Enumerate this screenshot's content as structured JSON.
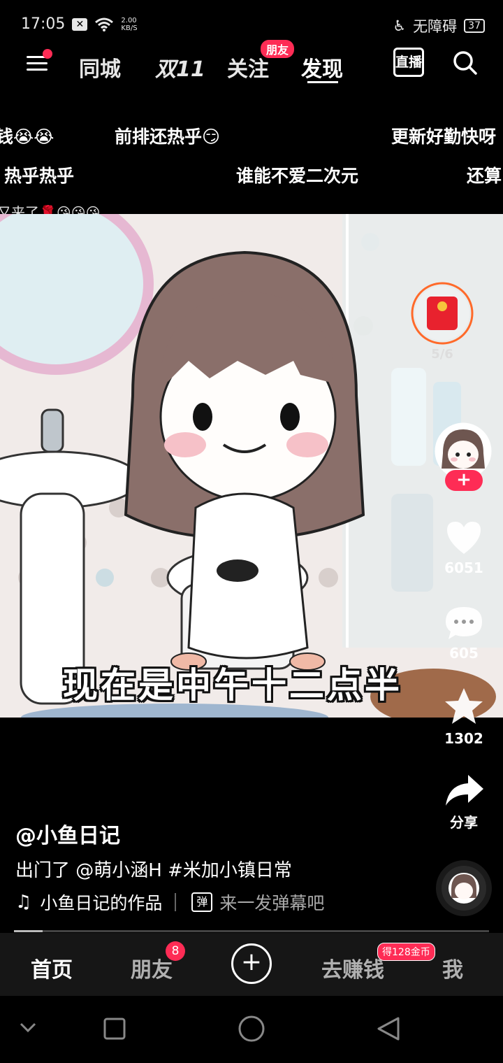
{
  "status": {
    "time": "17:05",
    "netspeed_top": "2.00",
    "netspeed_unit": "KB/S",
    "accessibility": "无障碍",
    "battery": "37"
  },
  "top_nav": {
    "tabs": [
      "同城",
      "双11",
      "关注",
      "发现"
    ],
    "active": "发现",
    "friend_badge": "朋友",
    "live_label": "直播"
  },
  "danmaku": [
    "钱😭😭",
    "前排还热乎😏",
    "更新好勤快呀",
    "热乎热乎",
    "谁能不爱二次元",
    "还算",
    "又来了🌹😘😘😘"
  ],
  "video": {
    "subtitle": "现在是中午十二点半"
  },
  "actions": {
    "redpacket_count": "5/6",
    "likes": "6051",
    "comments": "605",
    "favorites": "1302",
    "share_label": "分享"
  },
  "post": {
    "author": "@小鱼日记",
    "caption": "出门了 @萌小涵H #米加小镇日常",
    "music": "小鱼日记的作品",
    "danmu_icon": "弹",
    "danmu_hint": "来一发弹幕吧",
    "progress": 0.06
  },
  "tabbar": {
    "home": "首页",
    "friends": "朋友",
    "friends_badge": "8",
    "earn": "去赚钱",
    "coin_badge": "得128金币",
    "me": "我"
  },
  "colors": {
    "accent": "#fe2c55",
    "background": "#000000"
  }
}
